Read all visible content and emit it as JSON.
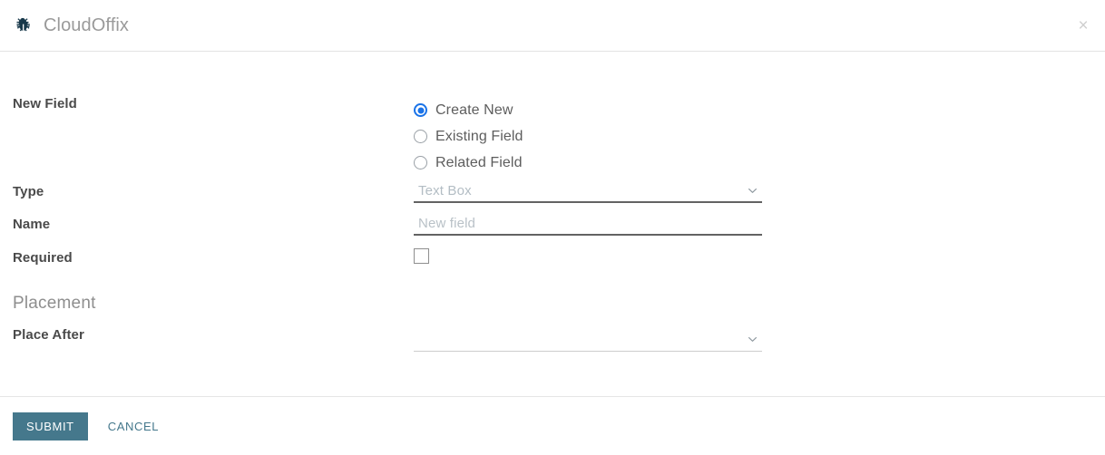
{
  "header": {
    "icon": "bug-icon",
    "title": "CloudOffix",
    "close_label": "×"
  },
  "form": {
    "new_field": {
      "label": "New Field",
      "options": [
        {
          "label": "Create New",
          "selected": true
        },
        {
          "label": "Existing Field",
          "selected": false
        },
        {
          "label": "Related Field",
          "selected": false
        }
      ]
    },
    "type": {
      "label": "Type",
      "value": "Text Box",
      "icon": "chevron-down-icon"
    },
    "name": {
      "label": "Name",
      "value": "",
      "placeholder": "New field"
    },
    "required": {
      "label": "Required",
      "checked": false
    },
    "placement": {
      "heading": "Placement",
      "place_after": {
        "label": "Place After",
        "value": "",
        "icon": "chevron-down-icon"
      }
    }
  },
  "footer": {
    "submit_label": "SUBMIT",
    "cancel_label": "CANCEL"
  },
  "colors": {
    "accent": "#45788c",
    "radio_selected": "#1a73e8",
    "label_text": "#4a4a4a",
    "muted_text": "#b3bdc4",
    "brand_icon": "#17384a"
  }
}
